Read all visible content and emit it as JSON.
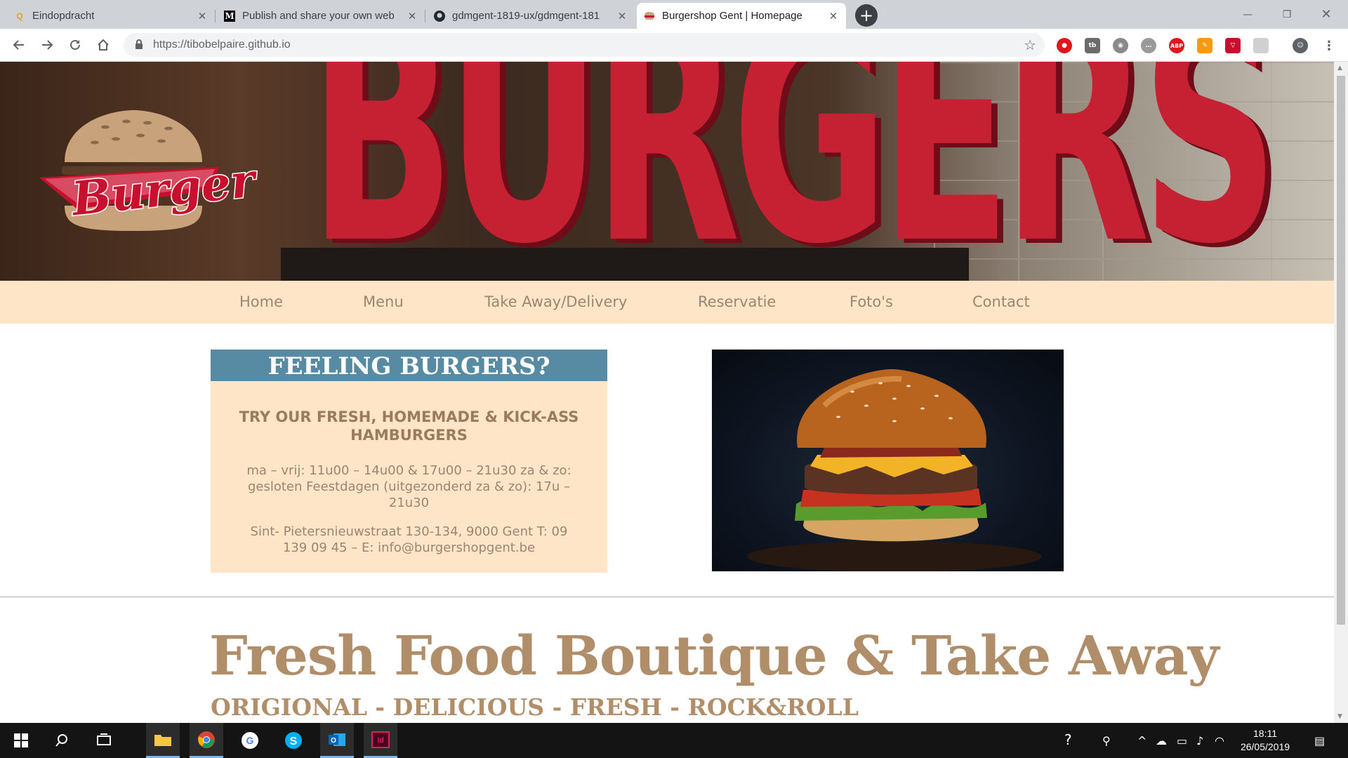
{
  "browser": {
    "tabs": [
      {
        "title": "Eindopdracht",
        "favicon": "q-icon",
        "active": false
      },
      {
        "title": "Publish and share your own web",
        "favicon": "medium-icon",
        "active": false
      },
      {
        "title": "gdmgent-1819-ux/gdmgent-181",
        "favicon": "github-icon",
        "active": false
      },
      {
        "title": "Burgershop Gent | Homepage",
        "favicon": "burger-icon",
        "active": true
      }
    ],
    "url": "https://tibobelpaire.github.io"
  },
  "site": {
    "logo_text": "Burger",
    "hero_sign": "BURGERS",
    "nav": [
      "Home",
      "Menu",
      "Take Away/Delivery",
      "Reservatie",
      "Foto's",
      "Contact"
    ],
    "card": {
      "title": "FEELING BURGERS?",
      "subtitle": "TRY OUR FRESH, HOMEMADE & KICK-ASS HAMBURGERS",
      "hours": "ma – vrij: 11u00 – 14u00 & 17u00 – 21u30 za & zo: gesloten Feestdagen (uitgezonderd za & zo): 17u – 21u30",
      "address": "Sint- Pietersnieuwstraat 130-134, 9000 Gent T: 09 139 09 45 – E: info@burgershopgent.be"
    },
    "main_title": "Fresh Food Boutique & Take Away",
    "tagline": "ORIGIONAL - DELICIOUS - FRESH - ROCK&ROLL"
  },
  "taskbar": {
    "time": "18:11",
    "date": "26/05/2019"
  },
  "colors": {
    "nav_bg": "#fee5c8",
    "card_header": "#568ba3",
    "brand_brown": "#b08e6a",
    "logo_red": "#c8102e"
  }
}
